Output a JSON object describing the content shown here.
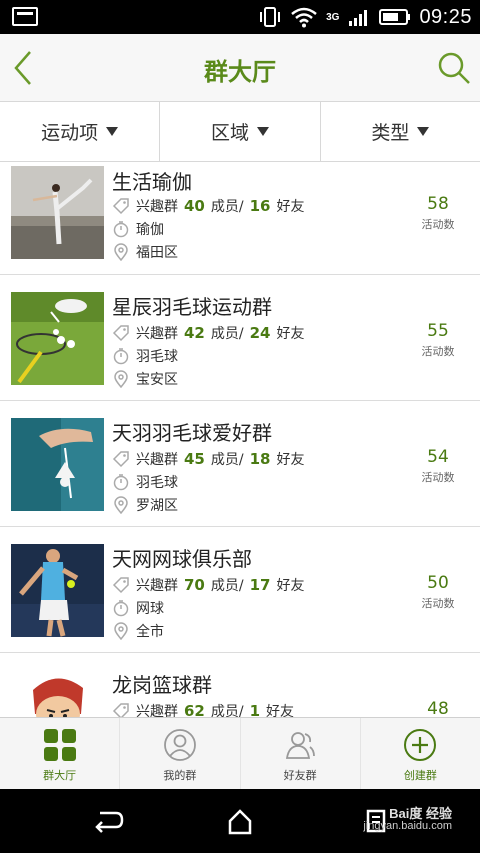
{
  "status_bar": {
    "network": "3G",
    "time": "09:25"
  },
  "header": {
    "title": "群大厅"
  },
  "filters": [
    {
      "label": "运动项"
    },
    {
      "label": "区域"
    },
    {
      "label": "类型"
    }
  ],
  "groups": [
    {
      "name": "生活瑜伽",
      "type": "兴趣群",
      "members": "40",
      "members_unit": "成员/",
      "friends": "16",
      "friends_unit": "好友",
      "sport": "瑜伽",
      "district": "福田区",
      "activities": "58",
      "activities_label": "活动数",
      "photo": "yoga-photo"
    },
    {
      "name": "星辰羽毛球运动群",
      "type": "兴趣群",
      "members": "42",
      "members_unit": "成员/",
      "friends": "24",
      "friends_unit": "好友",
      "sport": "羽毛球",
      "district": "宝安区",
      "activities": "55",
      "activities_label": "活动数",
      "photo": "badminton-photo"
    },
    {
      "name": "天羽羽毛球爱好群",
      "type": "兴趣群",
      "members": "45",
      "members_unit": "成员/",
      "friends": "18",
      "friends_unit": "好友",
      "sport": "羽毛球",
      "district": "罗湖区",
      "activities": "54",
      "activities_label": "活动数",
      "photo": "shuttlecock-photo"
    },
    {
      "name": "天网网球俱乐部",
      "type": "兴趣群",
      "members": "70",
      "members_unit": "成员/",
      "friends": "17",
      "friends_unit": "好友",
      "sport": "网球",
      "district": "全市",
      "activities": "50",
      "activities_label": "活动数",
      "photo": "tennis-photo"
    },
    {
      "name": "龙岗篮球群",
      "type": "兴趣群",
      "members": "62",
      "members_unit": "成员/",
      "friends": "1",
      "friends_unit": "好友",
      "activities": "48",
      "photo": "basketball-cartoon"
    }
  ],
  "tabs": [
    {
      "label": "群大厅",
      "icon": "grid-icon",
      "active": true
    },
    {
      "label": "我的群",
      "icon": "person-circle-icon"
    },
    {
      "label": "好友群",
      "icon": "friends-icon"
    },
    {
      "label": "创建群",
      "icon": "plus-circle-icon"
    }
  ],
  "watermark": {
    "line1": "Bai度 经验",
    "line2": "jingyan.baidu.com"
  },
  "colors": {
    "accent": "#4a7a12",
    "title": "#5a8a1a"
  }
}
